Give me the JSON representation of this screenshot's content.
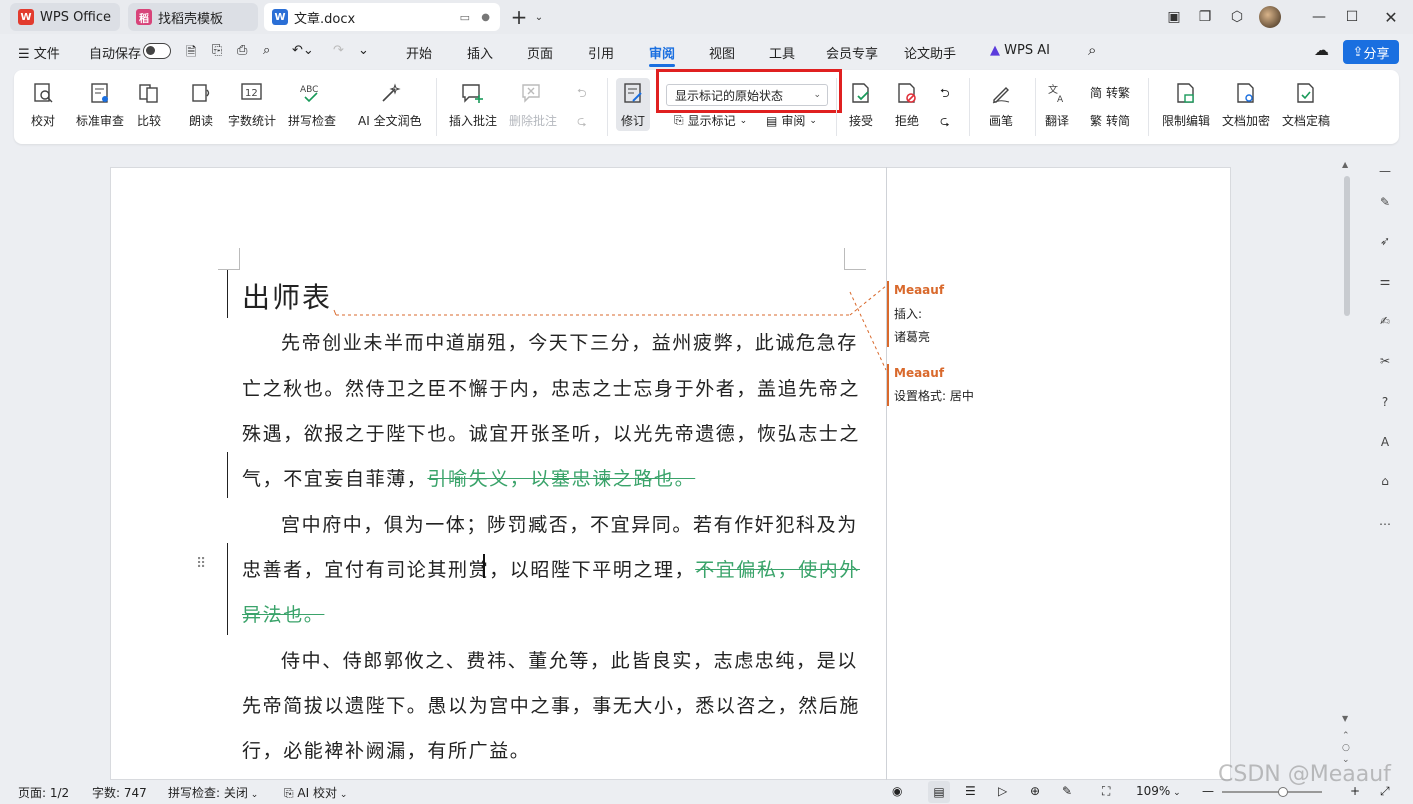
{
  "titlebar": {
    "tabs": [
      {
        "label": "WPS Office",
        "icon": "wps-logo-icon"
      },
      {
        "label": "找稻壳模板",
        "icon": "docer-icon"
      },
      {
        "label": "文章.docx",
        "icon": "word-doc-icon"
      }
    ]
  },
  "menubar": {
    "file_label": "文件",
    "autosave_label": "自动保存",
    "items": [
      "开始",
      "插入",
      "页面",
      "引用",
      "审阅",
      "视图",
      "工具",
      "会员专享",
      "论文助手",
      "WPS AI"
    ],
    "selected": "审阅",
    "share_label": "分享"
  },
  "ribbon": {
    "proofread": "校对",
    "standard_review": "标准审查",
    "compare": "比较",
    "read_aloud": "朗读",
    "word_count": "字数统计",
    "spell_check": "拼写检查",
    "ai_polish": "AI 全文润色",
    "insert_comment": "插入批注",
    "delete_comment": "删除批注",
    "track_changes": "修订",
    "display_mode": "显示标记的原始状态",
    "show_markup": "显示标记",
    "review_pane": "审阅",
    "accept": "接受",
    "reject": "拒绝",
    "ink": "画笔",
    "translate": "翻译",
    "to_traditional": "转繁",
    "to_simplified": "转简",
    "restrict_edit": "限制编辑",
    "encrypt": "文档加密",
    "finalize": "文档定稿"
  },
  "document": {
    "title": "出师表",
    "lines": [
      "先帝创业未半而中道崩殂，今天下三分，益州疲弊，此诚危急存",
      "亡之秋也。然侍卫之臣不懈于内，忠志之士忘身于外者，盖追先帝之",
      "殊遇，欲报之于陛下也。诚宜开张圣听，以光先帝遗德，恢弘志士之",
      "气，不宜妄自菲薄，",
      "宫中府中，俱为一体；陟罚臧否，不宜异同。若有作奸犯科及为",
      "忠善者，宜付有司论其刑赏，以昭陛下平明之理，",
      "侍中、侍郎郭攸之、费祎、董允等，此皆良实，志虑忠纯，是以",
      "先帝简拔以遗陛下。愚以为宫中之事，事无大小，悉以咨之，然后施",
      "行，必能裨补阙漏，有所广益。"
    ],
    "deleted_1": "引喻失义，以塞忠谏之路也。",
    "deleted_2a": "不宜偏私，使内外",
    "deleted_2b": "异法也。"
  },
  "comments": [
    {
      "author": "Meaauf",
      "line1": "插入:",
      "line2": "诸葛亮"
    },
    {
      "author": "Meaauf",
      "line1": "设置格式: 居中"
    }
  ],
  "statusbar": {
    "page": "页面: 1/2",
    "words": "字数: 747",
    "spell": "拼写检查: 关闭",
    "ai_proof": "AI 校对",
    "zoom": "109%",
    "watermark": "CSDN @Meaauf"
  },
  "colors": {
    "accent": "#1a6fe0",
    "highlight_box": "#e02020",
    "comment_author": "#d9692c",
    "deleted_text": "#3aa36a"
  }
}
